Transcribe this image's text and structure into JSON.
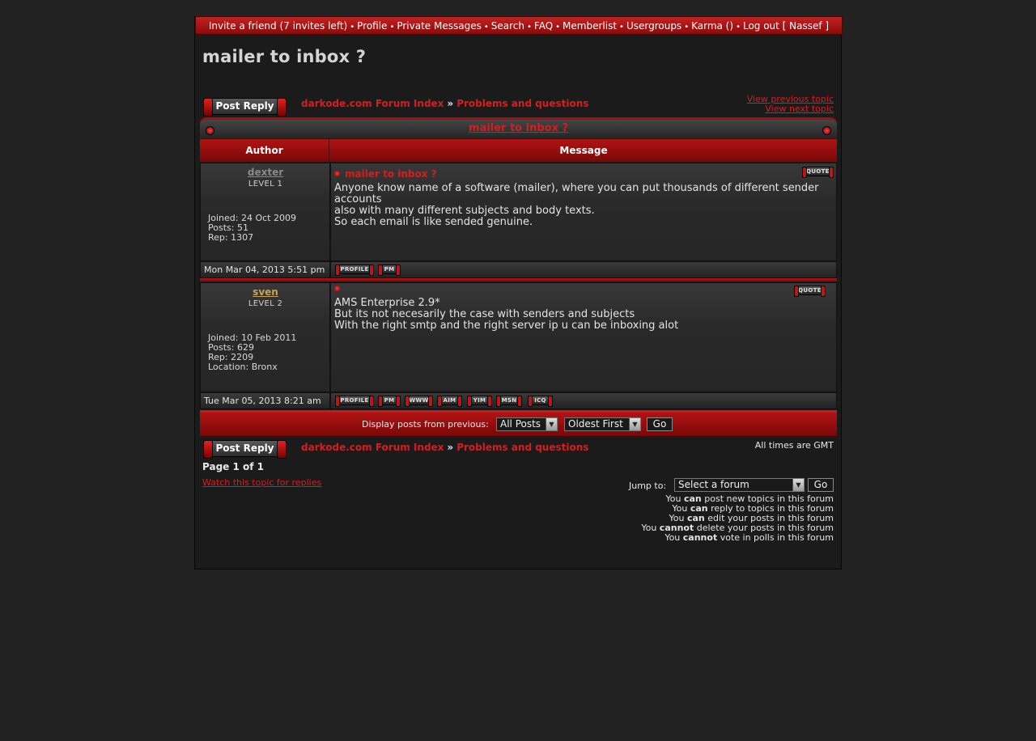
{
  "nav": {
    "items": [
      "Invite a friend (7 invites left)",
      "Profile",
      "Private Messages",
      "Search",
      "FAQ",
      "Memberlist",
      "Usergroups",
      "Karma ()",
      "Log out [ Nassef ]"
    ],
    "separator": "•"
  },
  "topic": {
    "title": "mailer to inbox ?",
    "post_reply_label": "Post Reply",
    "breadcrumb": [
      "darkode.com Forum Index",
      "Problems and questions"
    ],
    "breadcrumb_sep": "»",
    "prev_topic": "View previous topic",
    "next_topic": "View next topic"
  },
  "table": {
    "header_title": "mailer to inbox ?",
    "col_author": "Author",
    "col_message": "Message"
  },
  "posts": [
    {
      "author": "dexter",
      "level": "LEVEL 1",
      "joined": "Joined: 24 Oct 2009",
      "posts": "Posts: 51",
      "rep": "Rep: 1307",
      "subject": "mailer to inbox ?",
      "body": [
        "Anyone know name of a software (mailer), where you can put thousands of different sender accounts",
        "also with many different subjects and body texts.",
        "So each email is like sended genuine."
      ],
      "time": "Mon Mar 04, 2013 5:51 pm",
      "quote": "QUOTE",
      "buttons": [
        "PROFILE",
        "PM"
      ]
    },
    {
      "author": "sven",
      "level": "LEVEL 2",
      "joined": "Joined: 10 Feb 2011",
      "posts": "Posts: 629",
      "rep": "Rep: 2209",
      "location": "Location: Bronx",
      "subject": "",
      "body": [
        "AMS Enterprise 2.9*",
        "But its not necesarily the case with senders and subjects",
        "With the right smtp and the right server ip u can be inboxing alot"
      ],
      "time": "Tue Mar 05, 2013 8:21 am",
      "quote": "QUOTE",
      "buttons": [
        "PROFILE",
        "PM",
        "WWW",
        "AIM",
        "YIM",
        "MSN",
        "ICQ"
      ]
    }
  ],
  "display": {
    "label": "Display posts from previous:",
    "range": "All Posts",
    "order": "Oldest First",
    "go": "Go"
  },
  "bottom": {
    "timezone": "All times are GMT",
    "page": "Page 1 of 1",
    "watch": "Watch this topic for replies",
    "jump_label": "Jump to:",
    "jump_value": "Select a forum",
    "jump_go": "Go"
  },
  "permissions": [
    {
      "pre": "You ",
      "bold": "can",
      "post": " post new topics in this forum"
    },
    {
      "pre": "You ",
      "bold": "can",
      "post": " reply to topics in this forum"
    },
    {
      "pre": "You ",
      "bold": "can",
      "post": " edit your posts in this forum"
    },
    {
      "pre": "You ",
      "bold": "cannot",
      "post": " delete your posts in this forum"
    },
    {
      "pre": "You ",
      "bold": "cannot",
      "post": " vote in polls in this forum"
    }
  ],
  "colors": {
    "accent_red": "#d51e1e",
    "dexter": "#8a8a8a",
    "sven": "#c9a25a"
  }
}
